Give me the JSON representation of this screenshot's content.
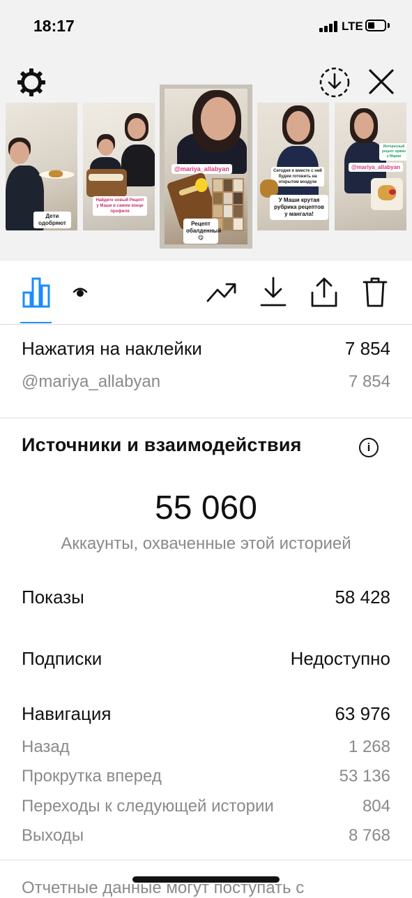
{
  "status_bar": {
    "time": "18:17",
    "network": "LTE"
  },
  "stories": [
    {
      "caption": "Дети одобряют"
    },
    {
      "caption": "Найдите новый Рецепт у Маши в самом конце профиля"
    },
    {
      "mention": "@mariya_allabyan",
      "caption": "Рецепт обалденный😋"
    },
    {
      "caption_top": "Сегодня я вместе с ней будем готовить на открытом воздухе",
      "caption": "У Маши крутая рубрика рецептов у мангала!"
    },
    {
      "caption_top": "Интересный рецепт прямо у Марии",
      "mention": "@mariya_allabyan"
    }
  ],
  "sticker_taps": {
    "label": "Нажатия на наклейки",
    "value": "7 854",
    "items": [
      {
        "label": "@mariya_allabyan",
        "value": "7 854"
      }
    ]
  },
  "discovery": {
    "title": "Источники и взаимодействия",
    "info_glyph": "i",
    "reach_value": "55 060",
    "reach_label": "Аккаунты, охваченные этой историей"
  },
  "impressions": {
    "label": "Показы",
    "value": "58 428"
  },
  "follows": {
    "label": "Подписки",
    "value": "Недоступно"
  },
  "navigation": {
    "label": "Навигация",
    "value": "63 976",
    "items": [
      {
        "label": "Назад",
        "value": "1 268"
      },
      {
        "label": "Прокрутка вперед",
        "value": "53 136"
      },
      {
        "label": "Переходы к следующей истории",
        "value": "804"
      },
      {
        "label": "Выходы",
        "value": "8 768"
      }
    ]
  },
  "footer_note": "Отчетные данные могут поступать с",
  "icons": {
    "settings": "gear-icon",
    "download_circle": "download-circle-icon",
    "close": "close-icon",
    "insights": "bar-chart-icon",
    "viewers": "eye-icon",
    "promote": "trending-up-icon",
    "save": "download-icon",
    "share": "share-icon",
    "delete": "trash-icon"
  },
  "colors": {
    "accent": "#1a8cff",
    "mention": "#d33a7a"
  }
}
